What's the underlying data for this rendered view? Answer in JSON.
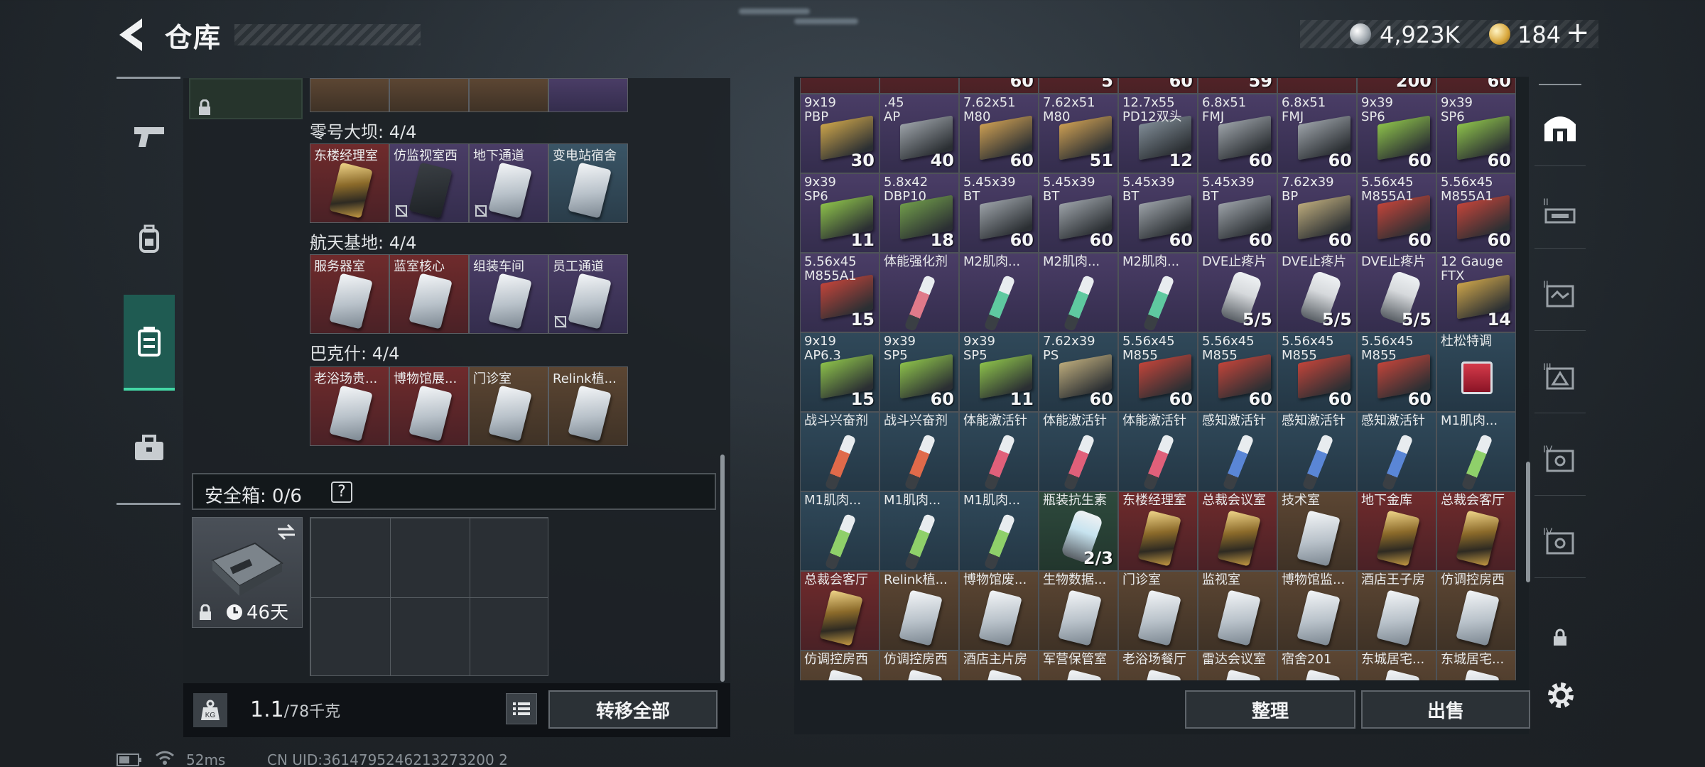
{
  "header": {
    "title": "仓库",
    "currency_silver": "4,923K",
    "currency_gold": "184",
    "plus_label": "+"
  },
  "left_nav": [
    "weapon-tab",
    "backpack-tab",
    "container-tab",
    "case-tab"
  ],
  "left_panel": {
    "sections": [
      {
        "label": "零号大坝: 4/4",
        "cards": [
          {
            "name": "东楼经理室",
            "style": "red",
            "gold": true,
            "nosell": false
          },
          {
            "name": "仿监视室西",
            "style": "purple",
            "gold": false,
            "nosell": true
          },
          {
            "name": "地下通道",
            "style": "purple",
            "gold": false,
            "nosell": true
          },
          {
            "name": "变电站宿舍",
            "style": "blue",
            "gold": false,
            "nosell": false
          }
        ]
      },
      {
        "label": "航天基地: 4/4",
        "cards": [
          {
            "name": "服务器室",
            "style": "red",
            "gold": false,
            "nosell": false
          },
          {
            "name": "蓝室核心",
            "style": "red",
            "gold": false,
            "nosell": false
          },
          {
            "name": "组装车间",
            "style": "purple",
            "gold": false,
            "nosell": false
          },
          {
            "name": "员工通道",
            "style": "purple",
            "gold": false,
            "nosell": true
          }
        ]
      },
      {
        "label": "巴克什: 4/4",
        "cards": [
          {
            "name": "老浴场贵...",
            "style": "red",
            "gold": false,
            "nosell": false
          },
          {
            "name": "博物馆展...",
            "style": "red",
            "gold": false,
            "nosell": false
          },
          {
            "name": "门诊室",
            "style": "brown",
            "gold": false,
            "nosell": false
          },
          {
            "name": "Relink植...",
            "style": "brown",
            "gold": false,
            "nosell": false
          }
        ]
      }
    ],
    "safe_box": {
      "label": "安全箱: 0/6",
      "help": "?",
      "timer": "46天"
    },
    "weight": {
      "current": "1.1",
      "max": "/78千克",
      "icon_text": "KG"
    },
    "transfer_all": "转移全部"
  },
  "right_panel": {
    "top_partial": [
      "",
      "",
      "60",
      "5",
      "60",
      "59",
      "",
      "200",
      "60"
    ],
    "rows": [
      [
        {
          "name": "9x19\nPBP",
          "count": "30",
          "type": "box",
          "color": "#c9a24a"
        },
        {
          "name": ".45\nAP",
          "count": "40",
          "type": "box",
          "color": "#9aa0a6"
        },
        {
          "name": "7.62x51\nM80",
          "count": "60",
          "type": "box",
          "color": "#c99c52"
        },
        {
          "name": "7.62x51\nM80",
          "count": "51",
          "type": "box",
          "color": "#c99c52"
        },
        {
          "name": "12.7x55\nPD12双头",
          "count": "12",
          "type": "box",
          "color": "#7e8a94"
        },
        {
          "name": "6.8x51\nFMJ",
          "count": "60",
          "type": "box",
          "color": "#9aa0a6"
        },
        {
          "name": "6.8x51\nFMJ",
          "count": "60",
          "type": "box",
          "color": "#9aa0a6"
        },
        {
          "name": "9x39\nSP6",
          "count": "60",
          "type": "box",
          "color": "#8bbf4a"
        },
        {
          "name": "9x39\nSP6",
          "count": "60",
          "type": "box",
          "color": "#8bbf4a"
        }
      ],
      [
        {
          "name": "9x39\nSP6",
          "count": "11",
          "type": "box",
          "color": "#8bbf4a"
        },
        {
          "name": "5.8x42\nDBP10",
          "count": "18",
          "type": "box",
          "color": "#6f9a4a"
        },
        {
          "name": "5.45x39\nBT",
          "count": "60",
          "type": "box",
          "color": "#9aa0a6"
        },
        {
          "name": "5.45x39\nBT",
          "count": "60",
          "type": "box",
          "color": "#9aa0a6"
        },
        {
          "name": "5.45x39\nBT",
          "count": "60",
          "type": "box",
          "color": "#9aa0a6"
        },
        {
          "name": "5.45x39\nBT",
          "count": "60",
          "type": "box",
          "color": "#9aa0a6"
        },
        {
          "name": "7.62x39\nBP",
          "count": "60",
          "type": "box",
          "color": "#b9a87a"
        },
        {
          "name": "5.56x45\nM855A1",
          "count": "60",
          "type": "box",
          "color": "#c0443a"
        },
        {
          "name": "5.56x45\nM855A1",
          "count": "60",
          "type": "box",
          "color": "#c0443a"
        }
      ],
      [
        {
          "name": "5.56x45\nM855A1",
          "count": "15",
          "type": "box",
          "color": "#c0443a"
        },
        {
          "name": "体能强化剂",
          "count": "",
          "type": "syringe",
          "color": "#e07a8a"
        },
        {
          "name": "M2肌肉...",
          "count": "",
          "type": "syringe",
          "color": "#5fc9a0"
        },
        {
          "name": "M2肌肉...",
          "count": "",
          "type": "syringe",
          "color": "#5fc9a0"
        },
        {
          "name": "M2肌肉...",
          "count": "",
          "type": "syringe",
          "color": "#5fc9a0"
        },
        {
          "name": "DVE止疼片",
          "count": "5/5",
          "type": "bottle",
          "color": "#d6d9dc"
        },
        {
          "name": "DVE止疼片",
          "count": "5/5",
          "type": "bottle",
          "color": "#d6d9dc"
        },
        {
          "name": "DVE止疼片",
          "count": "5/5",
          "type": "bottle",
          "color": "#d6d9dc"
        },
        {
          "name": "12 Gauge\nFTX",
          "count": "14",
          "type": "box",
          "color": "#c9a24a"
        }
      ],
      [
        {
          "name": "9x19\nAP6.3",
          "count": "15",
          "type": "box",
          "color": "#8bbf4a"
        },
        {
          "name": "9x39\nSP5",
          "count": "60",
          "type": "box",
          "color": "#8bbf4a"
        },
        {
          "name": "9x39\nSP5",
          "count": "11",
          "type": "box",
          "color": "#8bbf4a"
        },
        {
          "name": "7.62x39\nPS",
          "count": "60",
          "type": "box",
          "color": "#b9a87a"
        },
        {
          "name": "5.56x45\nM855",
          "count": "60",
          "type": "box",
          "color": "#c0443a"
        },
        {
          "name": "5.56x45\nM855",
          "count": "60",
          "type": "box",
          "color": "#c0443a"
        },
        {
          "name": "5.56x45\nM855",
          "count": "60",
          "type": "box",
          "color": "#c0443a"
        },
        {
          "name": "5.56x45\nM855",
          "count": "60",
          "type": "box",
          "color": "#c0443a"
        },
        {
          "name": "杜松特调",
          "count": "",
          "type": "glass",
          "color": "#d53a4a"
        }
      ],
      [
        {
          "name": "战斗兴奋剂",
          "count": "",
          "type": "syringe",
          "color": "#e06a4a"
        },
        {
          "name": "战斗兴奋剂",
          "count": "",
          "type": "syringe",
          "color": "#e06a4a"
        },
        {
          "name": "体能激活针",
          "count": "",
          "type": "syringe",
          "color": "#e0607a"
        },
        {
          "name": "体能激活针",
          "count": "",
          "type": "syringe",
          "color": "#e0607a"
        },
        {
          "name": "体能激活针",
          "count": "",
          "type": "syringe",
          "color": "#e0607a"
        },
        {
          "name": "感知激活针",
          "count": "",
          "type": "syringe",
          "color": "#5a86d6"
        },
        {
          "name": "感知激活针",
          "count": "",
          "type": "syringe",
          "color": "#5a86d6"
        },
        {
          "name": "感知激活针",
          "count": "",
          "type": "syringe",
          "color": "#5a86d6"
        },
        {
          "name": "M1肌肉...",
          "count": "",
          "type": "syringe",
          "color": "#8fd06a"
        }
      ],
      [
        {
          "name": "M1肌肉...",
          "count": "",
          "type": "syringe",
          "color": "#8fd06a"
        },
        {
          "name": "M1肌肉...",
          "count": "",
          "type": "syringe",
          "color": "#8fd06a"
        },
        {
          "name": "M1肌肉...",
          "count": "",
          "type": "syringe",
          "color": "#8fd06a"
        },
        {
          "name": "瓶装抗生素",
          "count": "2/3",
          "type": "bottle",
          "color": "#c7e3ef"
        },
        {
          "name": "东楼经理室",
          "count": "",
          "type": "keycard",
          "color": "gold"
        },
        {
          "name": "总裁会议室",
          "count": "",
          "type": "keycard",
          "color": "gold"
        },
        {
          "name": "技术室",
          "count": "",
          "type": "keycard",
          "color": "silver"
        },
        {
          "name": "地下金库",
          "count": "",
          "type": "keycard",
          "color": "gold"
        },
        {
          "name": "总裁会客厅",
          "count": "",
          "type": "keycard",
          "color": "gold"
        }
      ],
      [
        {
          "name": "总裁会客厅",
          "count": "",
          "type": "keycard",
          "color": "gold"
        },
        {
          "name": "Relink植...",
          "count": "",
          "type": "keycard",
          "color": "silver"
        },
        {
          "name": "博物馆废...",
          "count": "",
          "type": "keycard",
          "color": "silver"
        },
        {
          "name": "生物数据...",
          "count": "",
          "type": "keycard",
          "color": "silver"
        },
        {
          "name": "门诊室",
          "count": "",
          "type": "keycard",
          "color": "silver"
        },
        {
          "name": "监视室",
          "count": "",
          "type": "keycard",
          "color": "silver"
        },
        {
          "name": "博物馆监...",
          "count": "",
          "type": "keycard",
          "color": "silver"
        },
        {
          "name": "酒店王子房",
          "count": "",
          "type": "keycard",
          "color": "silver"
        },
        {
          "name": "仿调控房西",
          "count": "",
          "type": "keycard",
          "color": "silver"
        }
      ],
      [
        {
          "name": "仿调控房西",
          "count": "",
          "type": "keycard",
          "color": "silver"
        },
        {
          "name": "仿调控房西",
          "count": "",
          "type": "keycard",
          "color": "silver"
        },
        {
          "name": "酒店主片房",
          "count": "",
          "type": "keycard",
          "color": "silver"
        },
        {
          "name": "军营保管室",
          "count": "",
          "type": "keycard",
          "color": "silver"
        },
        {
          "name": "老浴场餐厅",
          "count": "",
          "type": "keycard",
          "color": "silver"
        },
        {
          "name": "雷达会议室",
          "count": "",
          "type": "keycard",
          "color": "silver"
        },
        {
          "name": "宿舍201",
          "count": "",
          "type": "keycard",
          "color": "silver"
        },
        {
          "name": "东城居宅...",
          "count": "",
          "type": "keycard",
          "color": "silver"
        },
        {
          "name": "东城居宅...",
          "count": "",
          "type": "keycard",
          "color": "silver"
        }
      ]
    ],
    "sort_label": "整理",
    "sell_label": "出售"
  },
  "right_tabs": [
    "vault-tab",
    "weapon-rack-tab-1",
    "storage-tab-2",
    "storage-tab-3",
    "storage-tab-4",
    "storage-tab-5",
    "lock-tab"
  ],
  "status_bar": {
    "ping": "52ms",
    "uid": "CN UID:3614795246213273200 2"
  }
}
